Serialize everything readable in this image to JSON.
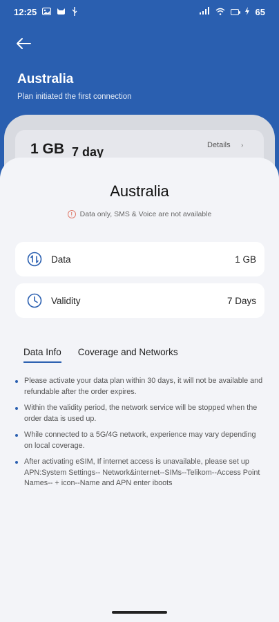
{
  "status_bar": {
    "time": "12:25",
    "battery": "65",
    "left_icons": [
      "photo-icon",
      "cat-icon",
      "usb-icon"
    ],
    "right_icons": [
      "signal-icon",
      "wifi-icon",
      "battery-icon",
      "charging-icon"
    ]
  },
  "header": {
    "title": "Australia",
    "subtitle": "Plan initiated the first connection",
    "bg_color": "#2a5fb0"
  },
  "background_plan": {
    "size": "1 GB",
    "days": "7 day",
    "details_label": "Details"
  },
  "sheet": {
    "title": "Australia",
    "notice": "Data only, SMS & Voice are not available",
    "rows": [
      {
        "label": "Data",
        "value": "1 GB",
        "icon": "data-exchange-icon"
      },
      {
        "label": "Validity",
        "value": "7 Days",
        "icon": "clock-icon"
      }
    ],
    "tabs": [
      {
        "label": "Data Info",
        "active": true
      },
      {
        "label": "Coverage and Networks",
        "active": false
      }
    ],
    "bullets": [
      "Please activate your data plan within 30 days, it will not be available and refundable after the order expires.",
      "Within the validity period, the network service will be stopped when the order data is used up.",
      "While connected to a 5G/4G network,  experience may vary depending on local coverage.",
      "After activating eSIM, If internet access is unavailable, please set up APN:System Settings-- Network&internet--SIMs--Telikom--Access Point Names-- + icon--Name and APN enter iboots"
    ]
  }
}
